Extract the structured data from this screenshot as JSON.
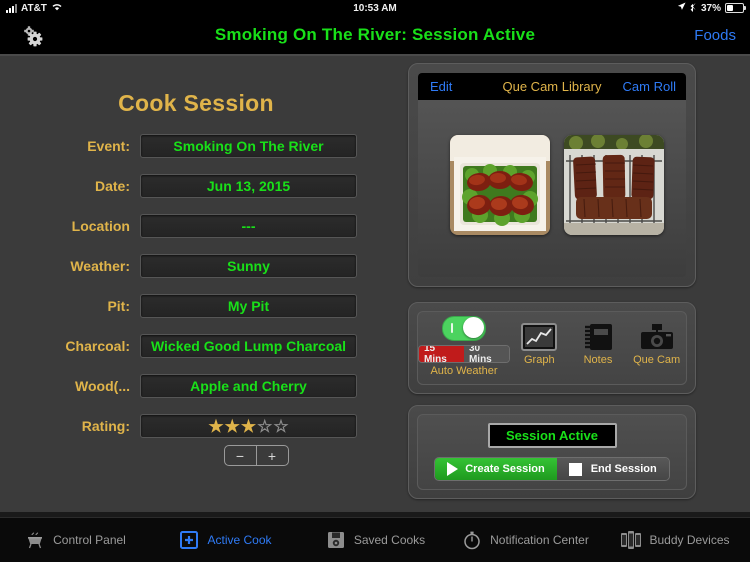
{
  "statusbar": {
    "carrier": "AT&T",
    "time": "10:53 AM",
    "battery_pct": "37%",
    "icons": [
      "signal-bars-icon",
      "wifi-icon",
      "location-arrow-icon",
      "bluetooth-icon",
      "battery-icon"
    ]
  },
  "navbar": {
    "title": "Smoking On The River: Session Active",
    "right_button": "Foods",
    "left_icon": "gears-icon"
  },
  "form": {
    "title": "Cook Session",
    "rows": [
      {
        "label": "Event:",
        "value": "Smoking On The River"
      },
      {
        "label": "Date:",
        "value": "Jun 13, 2015"
      },
      {
        "label": "Location",
        "value": "---"
      },
      {
        "label": "Weather:",
        "value": "Sunny"
      },
      {
        "label": "Pit:",
        "value": "My Pit"
      },
      {
        "label": "Charcoal:",
        "value": "Wicked Good Lump Charcoal"
      },
      {
        "label": "Wood(...",
        "value": "Apple and Cherry"
      }
    ],
    "rating": {
      "label": "Rating:",
      "value": 3,
      "max": 5,
      "filled_glyph": "★",
      "empty_glyph": "☆"
    },
    "stepper": {
      "decrement": "−",
      "increment": "+"
    }
  },
  "cam_library": {
    "edit_button": "Edit",
    "title": "Que Cam Library",
    "cam_roll_button": "Cam Roll",
    "photos": [
      {
        "caption": "chicken-thighs-in-container"
      },
      {
        "caption": "smoked-rib-racks-on-grill"
      }
    ]
  },
  "tools": {
    "auto_weather": {
      "label": "Auto Weather",
      "toggle_on": true,
      "segments": [
        {
          "label": "15 Mins",
          "selected": true
        },
        {
          "label": "30 Mins",
          "selected": false
        }
      ]
    },
    "buttons": [
      {
        "label": "Graph",
        "icon": "graph-icon"
      },
      {
        "label": "Notes",
        "icon": "notebook-icon"
      },
      {
        "label": "Que Cam",
        "icon": "camera-icon"
      }
    ]
  },
  "session": {
    "status": "Session Active",
    "create_label": "Create Session",
    "end_label": "End Session"
  },
  "tabbar": {
    "tabs": [
      {
        "label": "Control Panel",
        "icon": "grill-icon",
        "active": false
      },
      {
        "label": "Active Cook",
        "icon": "plus-box-icon",
        "active": true
      },
      {
        "label": "Saved Cooks",
        "icon": "floppy-disk-icon",
        "active": false
      },
      {
        "label": "Notification Center",
        "icon": "stopwatch-icon",
        "active": false
      },
      {
        "label": "Buddy Devices",
        "icon": "devices-icon",
        "active": false
      }
    ]
  },
  "colors": {
    "accent_green": "#19e019",
    "label_gold": "#e0b44a",
    "link_blue": "#2f7bf6",
    "segment_red": "#c01b1b",
    "toggle_green": "#4cd35f"
  }
}
